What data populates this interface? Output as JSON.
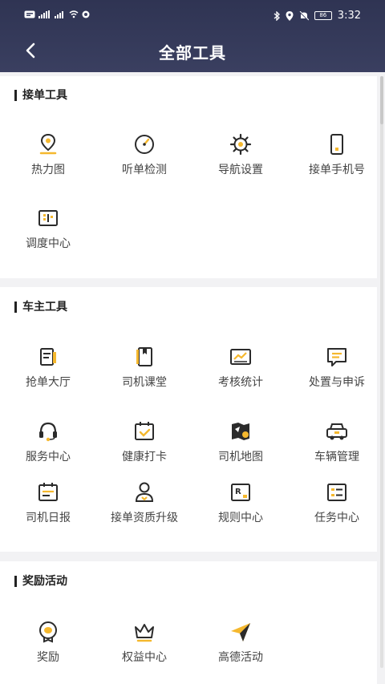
{
  "status_bar": {
    "time": "3:32",
    "battery": "86"
  },
  "nav": {
    "title": "全部工具"
  },
  "sections": [
    {
      "title": "接单工具",
      "items": [
        {
          "label": "热力图",
          "icon": "location-pin-icon"
        },
        {
          "label": "听单检测",
          "icon": "gauge-icon"
        },
        {
          "label": "导航设置",
          "icon": "gear-icon"
        },
        {
          "label": "接单手机号",
          "icon": "phone-icon"
        },
        {
          "label": "调度中心",
          "icon": "dispatch-icon"
        }
      ]
    },
    {
      "title": "车主工具",
      "items": [
        {
          "label": "抢单大厅",
          "icon": "order-hall-icon"
        },
        {
          "label": "司机课堂",
          "icon": "book-icon"
        },
        {
          "label": "考核统计",
          "icon": "chart-icon"
        },
        {
          "label": "处置与申诉",
          "icon": "message-icon"
        },
        {
          "label": "服务中心",
          "icon": "headset-icon"
        },
        {
          "label": "健康打卡",
          "icon": "calendar-check-icon"
        },
        {
          "label": "司机地图",
          "icon": "map-icon"
        },
        {
          "label": "车辆管理",
          "icon": "car-icon"
        },
        {
          "label": "司机日报",
          "icon": "daily-report-icon"
        },
        {
          "label": "接单资质升级",
          "icon": "user-upgrade-icon"
        },
        {
          "label": "规则中心",
          "icon": "rules-icon"
        },
        {
          "label": "任务中心",
          "icon": "task-icon"
        }
      ]
    },
    {
      "title": "奖励活动",
      "items": [
        {
          "label": "奖励",
          "icon": "reward-icon"
        },
        {
          "label": "权益中心",
          "icon": "crown-icon"
        },
        {
          "label": "高德活动",
          "icon": "paper-plane-icon"
        }
      ]
    }
  ],
  "colors": {
    "header": "#2f3453",
    "accent": "#f5b82e",
    "icon_stroke": "#2b2b2b"
  }
}
